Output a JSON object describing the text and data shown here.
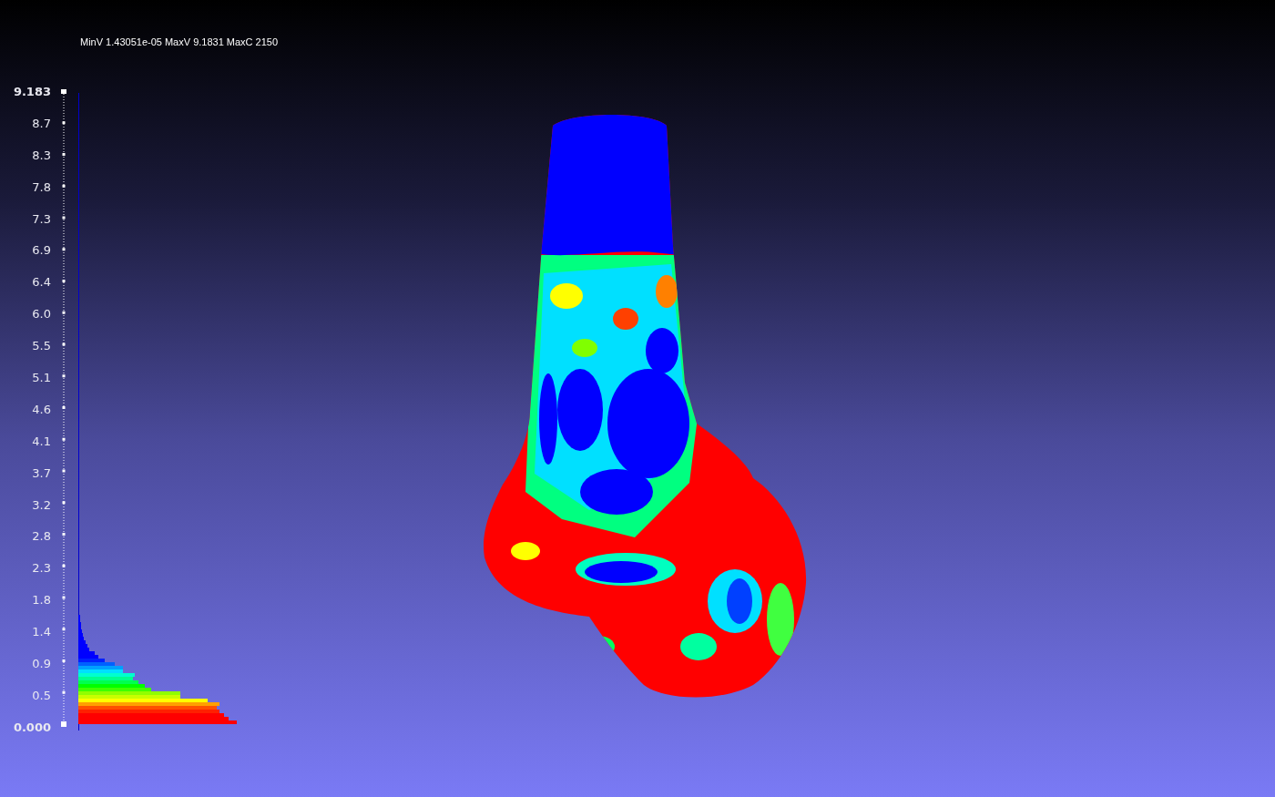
{
  "header_text": "MinV 1.43051e-05 MaxV 9.1831 MaxC 2150",
  "scale_labels": [
    {
      "text": "9.183",
      "kind": "end"
    },
    {
      "text": "8.7",
      "kind": "tick"
    },
    {
      "text": "8.3",
      "kind": "tick"
    },
    {
      "text": "7.8",
      "kind": "tick"
    },
    {
      "text": "7.3",
      "kind": "tick"
    },
    {
      "text": "6.9",
      "kind": "tick"
    },
    {
      "text": "6.4",
      "kind": "tick"
    },
    {
      "text": "6.0",
      "kind": "tick"
    },
    {
      "text": "5.5",
      "kind": "tick"
    },
    {
      "text": "5.1",
      "kind": "tick"
    },
    {
      "text": "4.6",
      "kind": "tick"
    },
    {
      "text": "4.1",
      "kind": "tick"
    },
    {
      "text": "3.7",
      "kind": "tick"
    },
    {
      "text": "3.2",
      "kind": "tick"
    },
    {
      "text": "2.8",
      "kind": "tick"
    },
    {
      "text": "2.3",
      "kind": "tick"
    },
    {
      "text": "1.8",
      "kind": "tick"
    },
    {
      "text": "1.4",
      "kind": "tick"
    },
    {
      "text": "0.9",
      "kind": "tick"
    },
    {
      "text": "0.5",
      "kind": "tick"
    },
    {
      "text": "0.000",
      "kind": "end"
    }
  ]
}
